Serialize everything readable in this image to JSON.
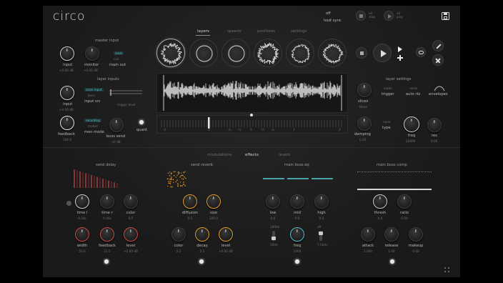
{
  "app": {
    "logo": "circo",
    "host_sync_state": "off",
    "host_sync_label": "host sync",
    "all_stop": "all\nstop",
    "all_play": "all\nplay"
  },
  "top_tabs": [
    "layers",
    "speeds",
    "positions",
    "settings"
  ],
  "master_input": {
    "title": "master input",
    "input_label": "input",
    "input_value": "+0.00 dB",
    "monitor_label": "monitor",
    "monitor_value": "+0.00 dB",
    "mode_main": "main",
    "mode_cue": "cue",
    "mode_label": "main out"
  },
  "layer_inputs": {
    "title": "layer inputs",
    "input_label": "input",
    "input_value": "+0.00 dB",
    "src_main": "main input",
    "src_busa": "buss",
    "src_label": "input src",
    "trigger_label": "trigger level",
    "feedback_label": "feedback",
    "feedback_value": "100.0",
    "mon_recording": "recording",
    "mon_muted": "muted",
    "mon_label": "mon mode",
    "bussend_label": "buss send",
    "bussend_value": "-inf dB",
    "quant_label": "quant"
  },
  "layer_settings": {
    "title": "layer settings",
    "trigger_top": "audio",
    "trigger_label": "trigger",
    "autortz_top": "never",
    "autortz_label": "auto rtz",
    "envelopes_label": "envelopes",
    "slices_label": "slices",
    "slices_value": "None",
    "type_top": "none",
    "type_label": "type",
    "freq_label": "freq",
    "freq_value": "20000",
    "res_label": "res",
    "res_value": "0.00",
    "damping_label": "damping",
    "damping_value": "0.20"
  },
  "speed_scale": [
    "-2",
    "-1",
    "-½",
    "-¼",
    "0",
    "¼",
    "½",
    "1",
    "2"
  ],
  "bottom_tabs": [
    "modulations",
    "effects",
    "levels"
  ],
  "send_delay": {
    "title": "send delay",
    "knobs": [
      {
        "label": "time l",
        "value": "0.20s"
      },
      {
        "label": "time r",
        "value": "0.40s"
      },
      {
        "label": "color",
        "value": "0.5"
      },
      {
        "label": "width",
        "value": "50.0"
      },
      {
        "label": "feedback",
        "value": "21.5"
      },
      {
        "label": "level",
        "value": "+0.00 dB"
      }
    ]
  },
  "send_reverb": {
    "title": "send reverb",
    "knobs": [
      {
        "label": "diffusion",
        "value": "0.5"
      },
      {
        "label": "size",
        "value": "100.0"
      },
      {
        "label": "color",
        "value": "0.5"
      },
      {
        "label": "decay",
        "value": "5.5"
      },
      {
        "label": "level",
        "value": "+0.00 dB"
      }
    ]
  },
  "main_buss_eq": {
    "title": "main buss eq",
    "knobs": [
      {
        "label": "low",
        "value": "0.0"
      },
      {
        "label": "mid",
        "value": "0.0"
      },
      {
        "label": "high",
        "value": "0.0"
      },
      {
        "label": "freq",
        "value": "1000"
      }
    ],
    "lowcut_top": "180Hz",
    "lowcut_bottom": "50Hz",
    "highcut_top": "off",
    "highcut_bottom": "7.5kHz"
  },
  "main_buss_comp": {
    "title": "main buss comp",
    "knobs": [
      {
        "label": "thresh",
        "value": "0.0"
      },
      {
        "label": "ratio",
        "value": "0.00"
      },
      {
        "label": "attack",
        "value": "1.000"
      },
      {
        "label": "release",
        "value": "1.00"
      },
      {
        "label": "makeup",
        "value": "0.00"
      }
    ]
  },
  "colors": {
    "accent_teal": "#52c1c7",
    "accent_orange": "#e39a2a",
    "accent_red": "#c94a4a",
    "bg": "#1b1b1b"
  }
}
